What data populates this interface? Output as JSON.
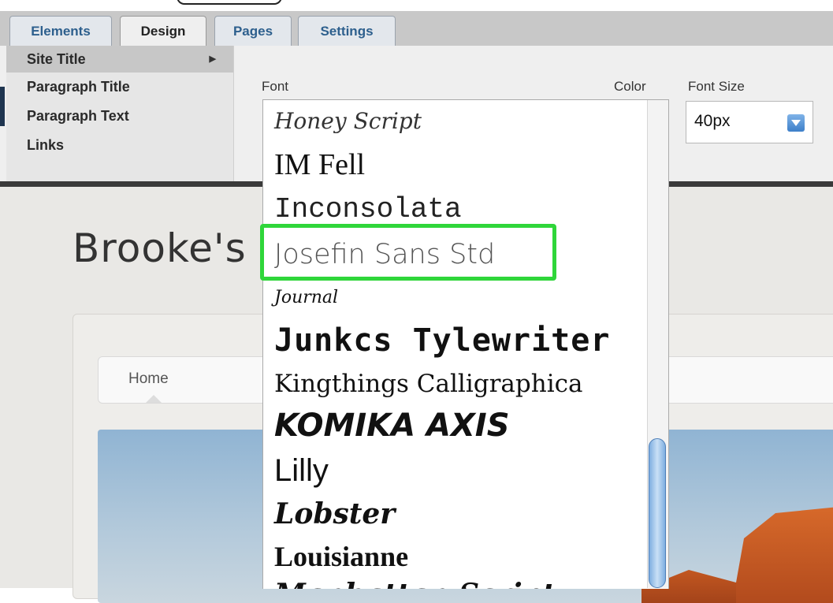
{
  "tabs": [
    {
      "label": "Elements"
    },
    {
      "label": "Design"
    },
    {
      "label": "Pages"
    },
    {
      "label": "Settings"
    }
  ],
  "menu": {
    "items": [
      {
        "label": "Site Title",
        "selected": true
      },
      {
        "label": "Paragraph Title"
      },
      {
        "label": "Paragraph Text"
      },
      {
        "label": "Links"
      }
    ]
  },
  "controls": {
    "font_label": "Font",
    "color_label": "Color",
    "size_label": "Font Size",
    "size_value": "40px"
  },
  "font_list": [
    "Honey Script",
    "IM Fell",
    "Inconsolata",
    "Josefin Sans Std",
    "Journal",
    "Junkcs Tylewriter",
    "Kingthings Calligraphica",
    "KOMIKA AXIS",
    "Lilly",
    "Lobster",
    "Louisianne",
    "Manhattan Script"
  ],
  "highlighted_font": "Josefin Sans Std",
  "preview": {
    "site_title": "Brooke's",
    "nav_home": "Home"
  },
  "colors": {
    "highlight": "#2fd63a",
    "tab_text": "#2d5f8d",
    "scroll_thumb": "#7eaee0"
  }
}
